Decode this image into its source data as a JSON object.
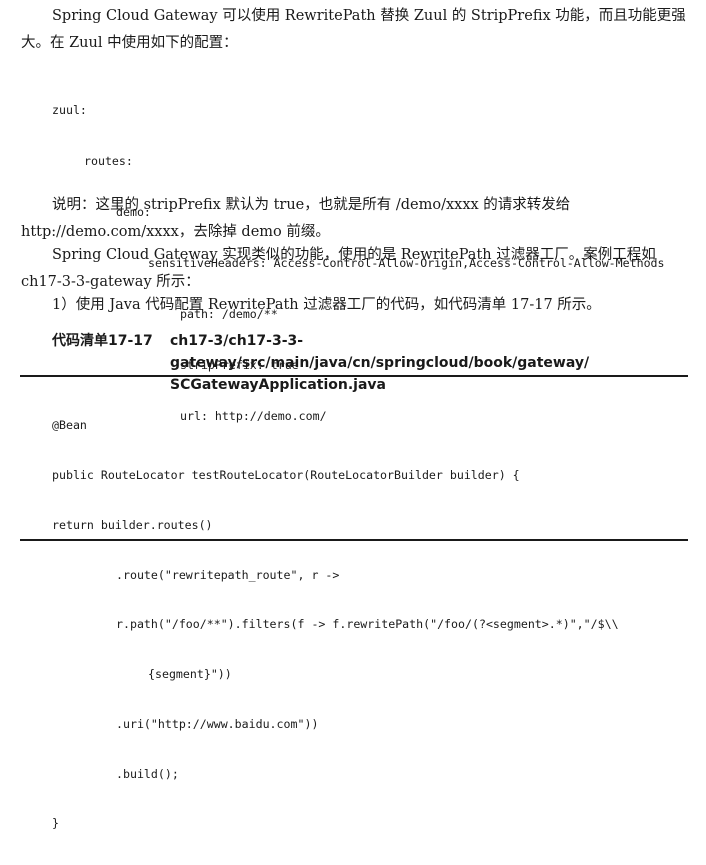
{
  "paragraphs": {
    "intro": "Spring Cloud Gateway 可以使用 RewritePath 替换 Zuul 的 StripPrefix 功能，而且功能更强大。在 Zuul 中使用如下的配置：",
    "explanation": "说明：这里的 stripPrefix 默认为 true，也就是所有 /demo/xxxx 的请求转发给 http://demo.com/xxxx，去除掉 demo 前缀。",
    "similar": "Spring Cloud Gateway 实现类似的功能，使用的是 RewritePath 过滤器工厂。案例工程如 ch17-3-3-gateway 所示：",
    "step1": "1）使用 Java 代码配置 RewritePath 过滤器工厂的代码，如代码清单 17-17 所示。"
  },
  "yaml_config": {
    "lines": [
      "zuul:",
      "routes:",
      "demo:",
      "sensitiveHeaders: Access-Control-Allow-Origin,Access-Control-Allow-Methods",
      "path: /demo/**",
      "stripPrefix: true",
      "url: http://demo.com/"
    ]
  },
  "listing": {
    "title": "代码清单17-17",
    "path_line1": "ch17-3/ch17-3-3-gateway/src/main/java/cn/springcloud/book/gateway/",
    "path_line2": "SCGatewayApplication.java"
  },
  "java_code": {
    "lines": [
      "@Bean",
      "public RouteLocator testRouteLocator(RouteLocatorBuilder builder) {",
      "return builder.routes()",
      ".route(\"rewritepath_route\", r ->",
      "r.path(\"/foo/**\").filters(f -> f.rewritePath(\"/foo/(?<segment>.*)\",\"/$\\\\",
      "{segment}\"))",
      ".uri(\"http://www.baidu.com\"))",
      ".build();",
      "}"
    ]
  }
}
